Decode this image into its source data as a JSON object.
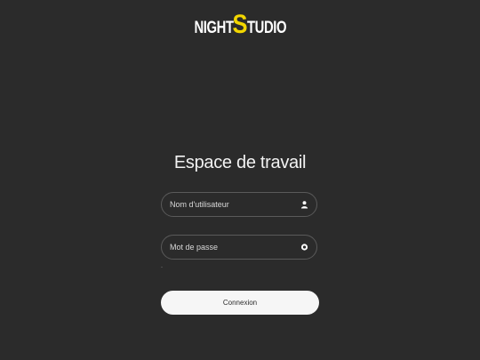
{
  "brand": {
    "logo_part1": "NIGHT",
    "logo_part2": "S",
    "logo_part3": "TUDIO",
    "accent_color": "#f2d600"
  },
  "login": {
    "title": "Espace de travail",
    "username_placeholder": "Nom d'utilisateur",
    "username_value": "",
    "username_icon": "user-icon",
    "password_placeholder": "Mot de passe",
    "password_value": "",
    "password_icon": "eye-icon",
    "submit_label": "Connexion"
  },
  "colors": {
    "background": "#2b2b2b",
    "field_border": "#5a5a5a",
    "button_bg": "#f6f6f6"
  }
}
